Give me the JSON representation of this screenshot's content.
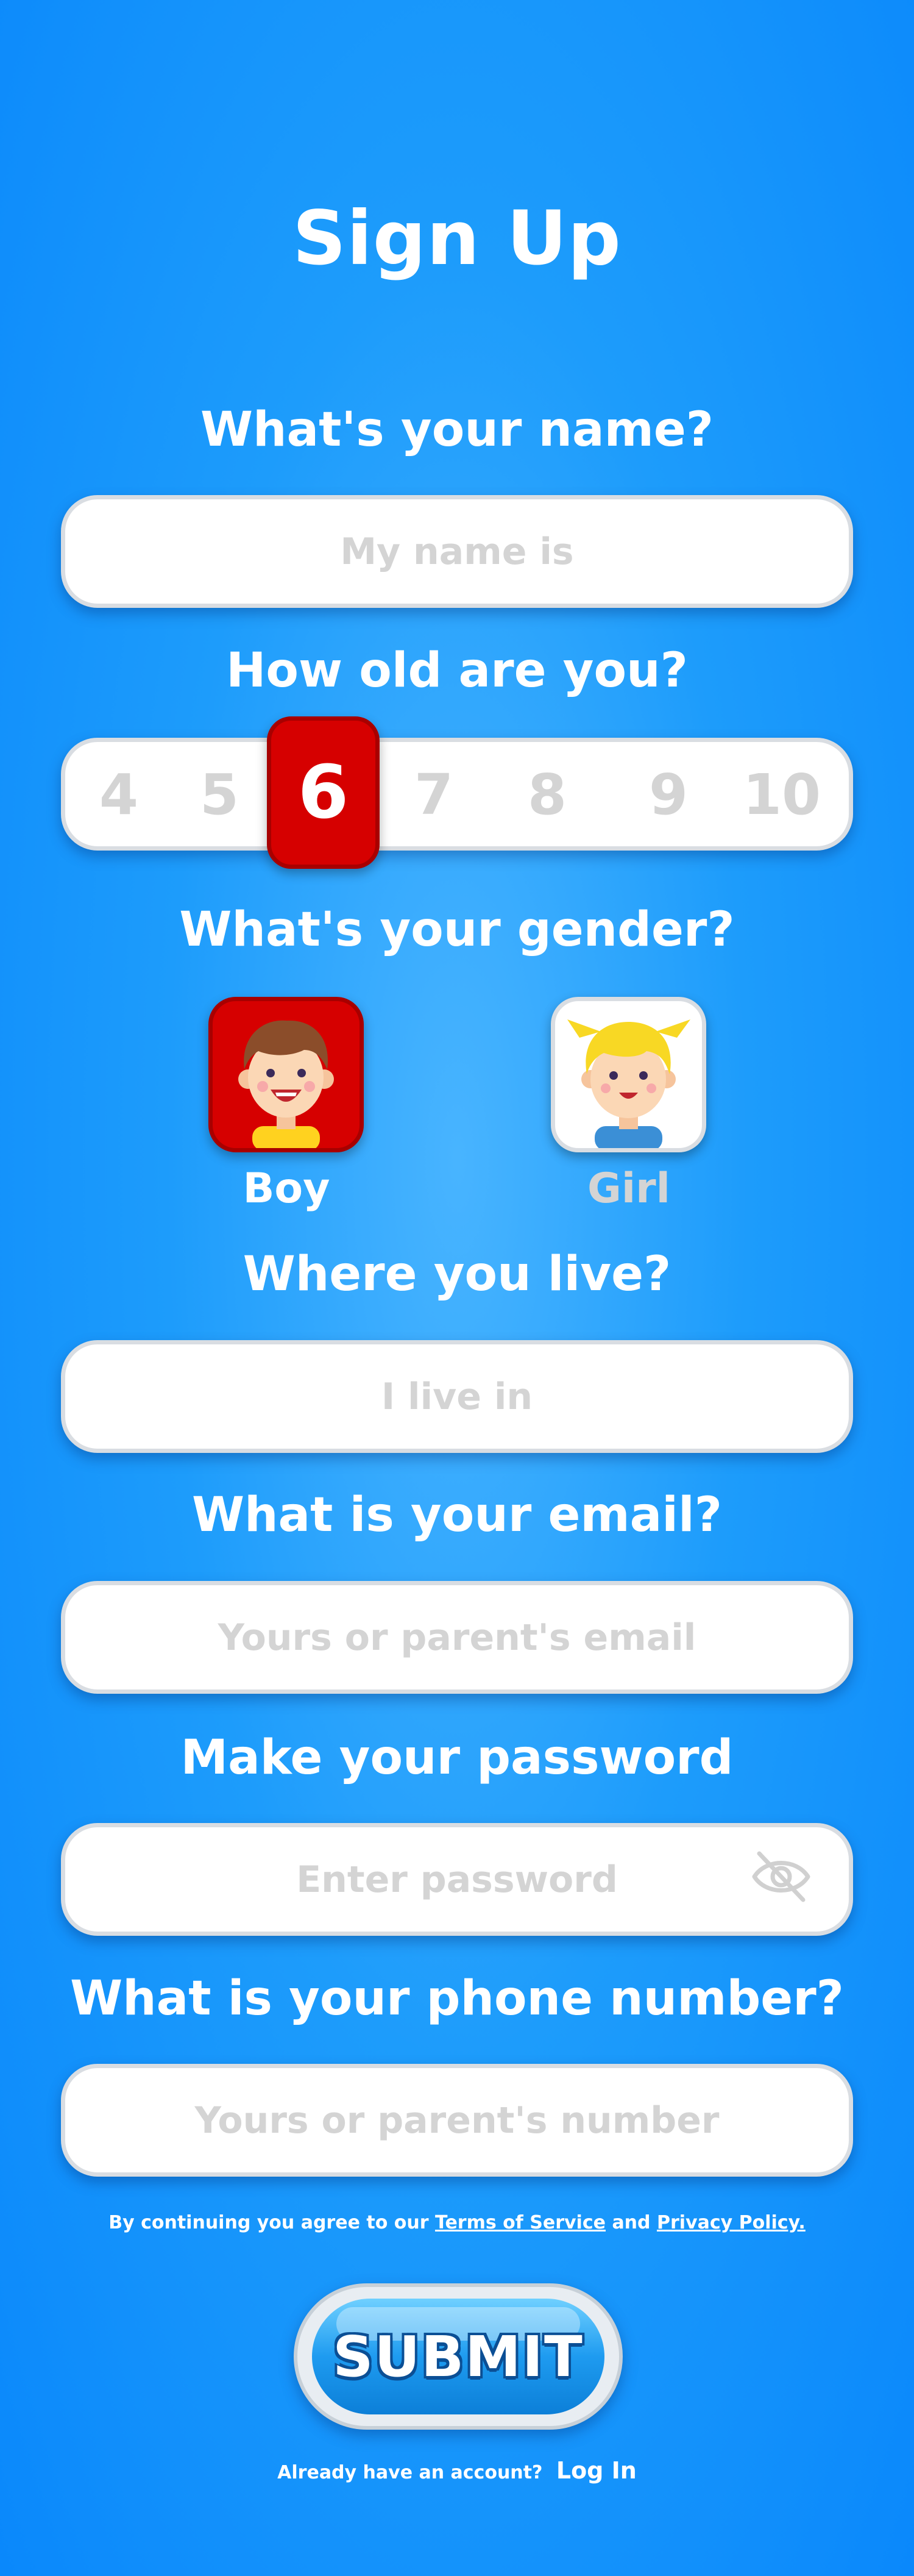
{
  "title": "Sign Up",
  "name": {
    "question": "What's your name?",
    "placeholder": "My name is"
  },
  "age": {
    "question": "How old are you?",
    "options": [
      "4",
      "5",
      "6",
      "7",
      "8",
      "9",
      "10"
    ],
    "selected": "6"
  },
  "gender": {
    "question": "What's your gender?",
    "boy_label": "Boy",
    "girl_label": "Girl",
    "selected": "Boy",
    "selected_color": "#d60000"
  },
  "location": {
    "question": "Where you live?",
    "placeholder": "I live in"
  },
  "email": {
    "question": "What is your email?",
    "placeholder": "Yours or parent's email"
  },
  "password": {
    "question": "Make your password",
    "placeholder": "Enter password",
    "toggle_icon": "eye-off-icon"
  },
  "phone": {
    "question": "What is your phone number?",
    "placeholder": "Yours or parent's number"
  },
  "terms": {
    "prefix": "By continuing you agree to our",
    "terms_link": "Terms of Service",
    "and": "and",
    "privacy_link": "Privacy Policy."
  },
  "submit_label": "SUBMIT",
  "login": {
    "prompt": "Already have an account?",
    "link": "Log In"
  },
  "colors": {
    "background": "#1d9cfb",
    "accent": "#d60000",
    "placeholder": "#d4d4d4"
  }
}
